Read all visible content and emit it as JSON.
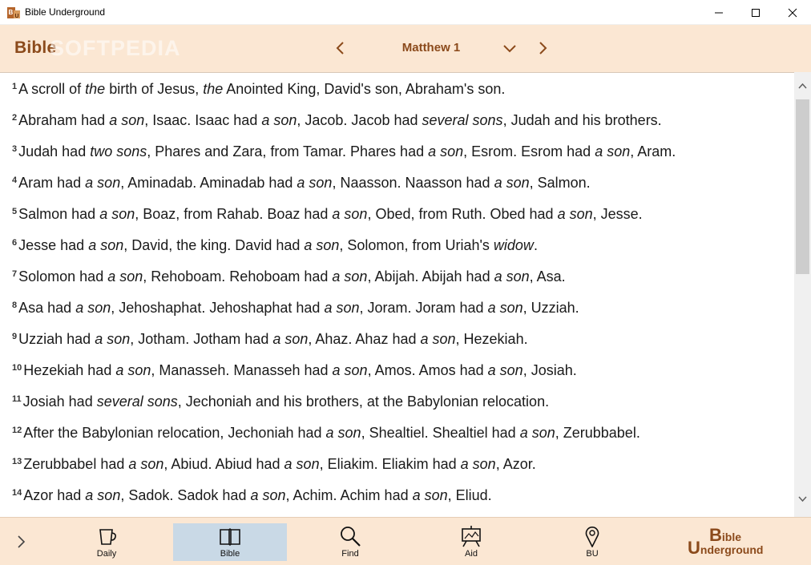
{
  "window": {
    "title": "Bible Underground"
  },
  "header": {
    "brand": "Bible",
    "watermark": "SOFTPEDIA",
    "chapter": "Matthew 1"
  },
  "verses": [
    {
      "num": "1",
      "parts": [
        {
          "t": "A scroll of ",
          "i": false
        },
        {
          "t": "the",
          "i": true
        },
        {
          "t": " birth of Jesus, ",
          "i": false
        },
        {
          "t": "the",
          "i": true
        },
        {
          "t": " Anointed King, David's son, Abraham's son.",
          "i": false
        }
      ]
    },
    {
      "num": "2",
      "parts": [
        {
          "t": "Abraham had ",
          "i": false
        },
        {
          "t": "a son",
          "i": true
        },
        {
          "t": ", Isaac. Isaac had ",
          "i": false
        },
        {
          "t": "a son",
          "i": true
        },
        {
          "t": ", Jacob. Jacob had ",
          "i": false
        },
        {
          "t": "several sons",
          "i": true
        },
        {
          "t": ", Judah and his brothers.",
          "i": false
        }
      ]
    },
    {
      "num": "3",
      "parts": [
        {
          "t": "Judah had ",
          "i": false
        },
        {
          "t": "two sons",
          "i": true
        },
        {
          "t": ", Phares and Zara, from Tamar. Phares had ",
          "i": false
        },
        {
          "t": "a son",
          "i": true
        },
        {
          "t": ", Esrom. Esrom had ",
          "i": false
        },
        {
          "t": "a son",
          "i": true
        },
        {
          "t": ", Aram.",
          "i": false
        }
      ]
    },
    {
      "num": "4",
      "parts": [
        {
          "t": "Aram had ",
          "i": false
        },
        {
          "t": "a son",
          "i": true
        },
        {
          "t": ", Aminadab. Aminadab had ",
          "i": false
        },
        {
          "t": "a son",
          "i": true
        },
        {
          "t": ", Naasson. Naasson had ",
          "i": false
        },
        {
          "t": "a son",
          "i": true
        },
        {
          "t": ", Salmon.",
          "i": false
        }
      ]
    },
    {
      "num": "5",
      "parts": [
        {
          "t": "Salmon had ",
          "i": false
        },
        {
          "t": "a son",
          "i": true
        },
        {
          "t": ", Boaz, from Rahab. Boaz had ",
          "i": false
        },
        {
          "t": "a son",
          "i": true
        },
        {
          "t": ", Obed, from Ruth. Obed had ",
          "i": false
        },
        {
          "t": "a son",
          "i": true
        },
        {
          "t": ", Jesse.",
          "i": false
        }
      ]
    },
    {
      "num": "6",
      "parts": [
        {
          "t": "Jesse had ",
          "i": false
        },
        {
          "t": "a son",
          "i": true
        },
        {
          "t": ", David, the king. David had ",
          "i": false
        },
        {
          "t": "a son",
          "i": true
        },
        {
          "t": ", Solomon, from Uriah's ",
          "i": false
        },
        {
          "t": "widow",
          "i": true
        },
        {
          "t": ".",
          "i": false
        }
      ]
    },
    {
      "num": "7",
      "parts": [
        {
          "t": "Solomon had ",
          "i": false
        },
        {
          "t": "a son",
          "i": true
        },
        {
          "t": ", Rehoboam. Rehoboam had ",
          "i": false
        },
        {
          "t": "a son",
          "i": true
        },
        {
          "t": ", Abijah. Abijah had ",
          "i": false
        },
        {
          "t": "a son",
          "i": true
        },
        {
          "t": ", Asa.",
          "i": false
        }
      ]
    },
    {
      "num": "8",
      "parts": [
        {
          "t": "Asa had ",
          "i": false
        },
        {
          "t": "a son",
          "i": true
        },
        {
          "t": ", Jehoshaphat. Jehoshaphat had ",
          "i": false
        },
        {
          "t": "a son",
          "i": true
        },
        {
          "t": ", Joram. Joram had ",
          "i": false
        },
        {
          "t": "a son",
          "i": true
        },
        {
          "t": ", Uzziah.",
          "i": false
        }
      ]
    },
    {
      "num": "9",
      "parts": [
        {
          "t": "Uzziah had ",
          "i": false
        },
        {
          "t": "a son",
          "i": true
        },
        {
          "t": ", Jotham. Jotham had ",
          "i": false
        },
        {
          "t": "a son",
          "i": true
        },
        {
          "t": ", Ahaz. Ahaz had ",
          "i": false
        },
        {
          "t": "a son",
          "i": true
        },
        {
          "t": ", Hezekiah.",
          "i": false
        }
      ]
    },
    {
      "num": "10",
      "parts": [
        {
          "t": "Hezekiah had ",
          "i": false
        },
        {
          "t": "a son",
          "i": true
        },
        {
          "t": ", Manasseh. Manasseh had ",
          "i": false
        },
        {
          "t": "a son",
          "i": true
        },
        {
          "t": ", Amos. Amos had ",
          "i": false
        },
        {
          "t": "a son",
          "i": true
        },
        {
          "t": ", Josiah.",
          "i": false
        }
      ]
    },
    {
      "num": "11",
      "parts": [
        {
          "t": "Josiah had ",
          "i": false
        },
        {
          "t": "several sons",
          "i": true
        },
        {
          "t": ", Jechoniah and his brothers, at the Babylonian relocation.",
          "i": false
        }
      ]
    },
    {
      "num": "12",
      "parts": [
        {
          "t": "After the Babylonian relocation, Jechoniah had ",
          "i": false
        },
        {
          "t": "a son",
          "i": true
        },
        {
          "t": ", Shealtiel. Shealtiel had ",
          "i": false
        },
        {
          "t": "a son",
          "i": true
        },
        {
          "t": ", Zerubbabel.",
          "i": false
        }
      ]
    },
    {
      "num": "13",
      "parts": [
        {
          "t": "Zerubbabel had ",
          "i": false
        },
        {
          "t": "a son",
          "i": true
        },
        {
          "t": ", Abiud. Abiud had ",
          "i": false
        },
        {
          "t": "a son",
          "i": true
        },
        {
          "t": ", Eliakim. Eliakim had ",
          "i": false
        },
        {
          "t": "a son",
          "i": true
        },
        {
          "t": ", Azor.",
          "i": false
        }
      ]
    },
    {
      "num": "14",
      "parts": [
        {
          "t": "Azor had ",
          "i": false
        },
        {
          "t": "a son",
          "i": true
        },
        {
          "t": ", Sadok. Sadok had ",
          "i": false
        },
        {
          "t": "a son",
          "i": true
        },
        {
          "t": ", Achim. Achim had ",
          "i": false
        },
        {
          "t": "a son",
          "i": true
        },
        {
          "t": ", Eliud.",
          "i": false
        }
      ]
    }
  ],
  "bottom_nav": {
    "items": [
      {
        "label": "Daily",
        "icon": "cup-icon"
      },
      {
        "label": "Bible",
        "icon": "book-icon",
        "active": true
      },
      {
        "label": "Find",
        "icon": "magnifier-icon"
      },
      {
        "label": "Aid",
        "icon": "easel-icon"
      },
      {
        "label": "BU",
        "icon": "map-pin-icon"
      }
    ],
    "logo": {
      "line1_big": "B",
      "line1_rest": "ible",
      "line2_big": "U",
      "line2_rest": "nderground"
    }
  },
  "colors": {
    "accent": "#8b4a1b",
    "header_bg": "#fbe7d3",
    "active_tab_bg": "#c9d9e6"
  }
}
